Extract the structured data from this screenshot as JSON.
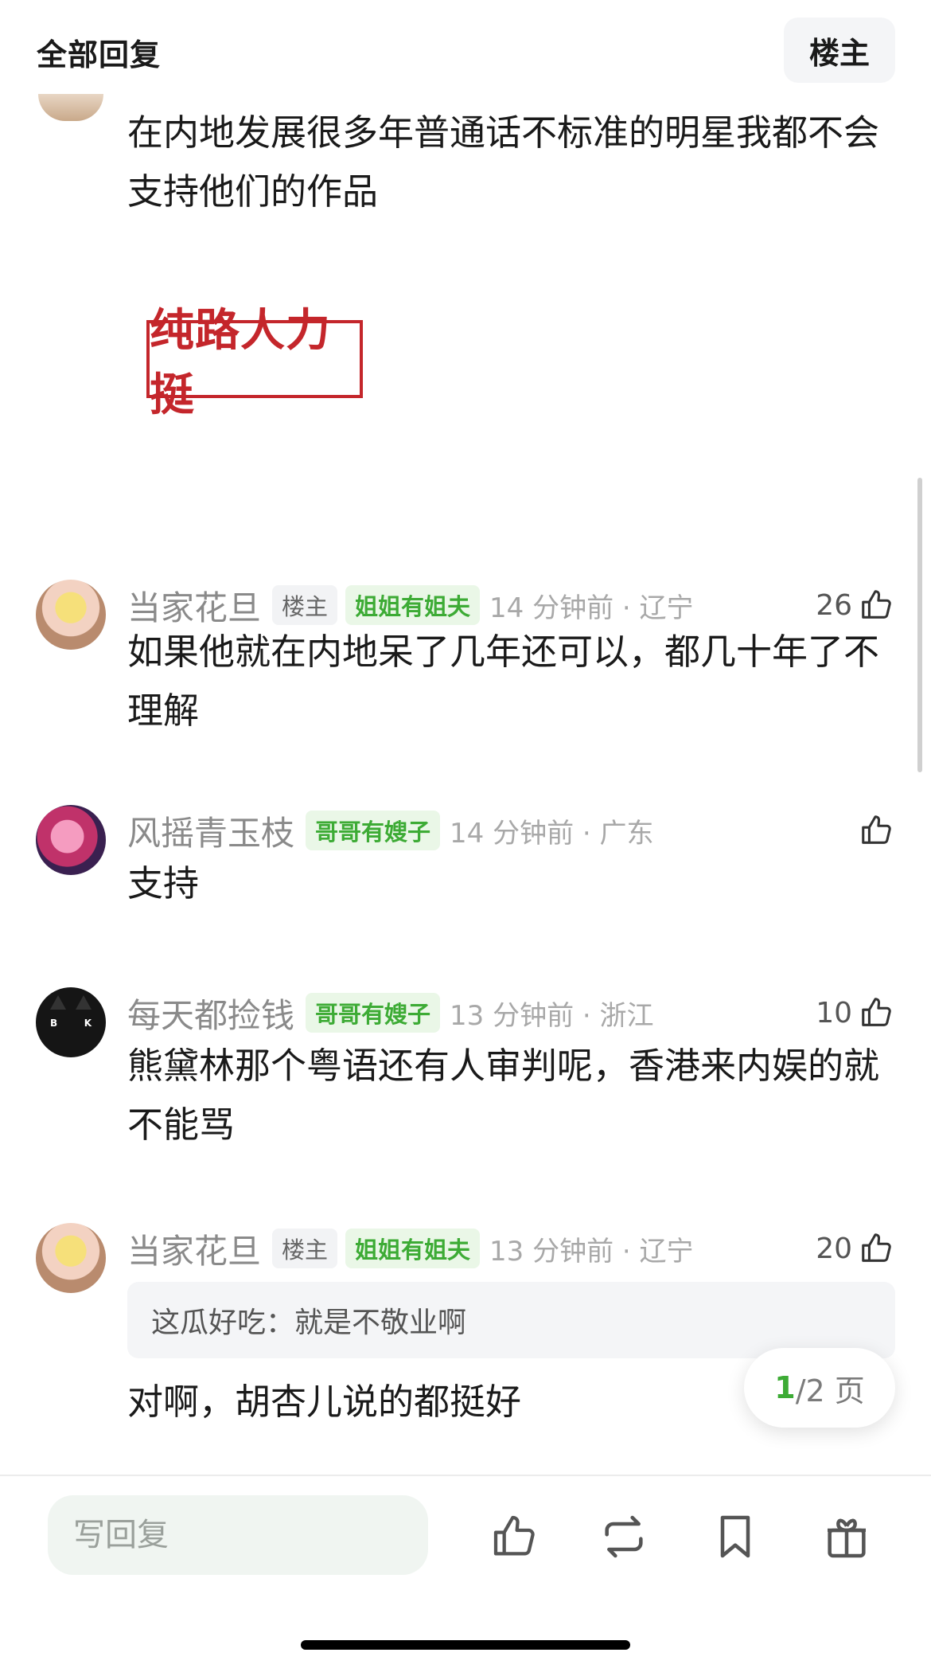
{
  "header": {
    "title": "全部回复",
    "op_button": "楼主"
  },
  "first_post": {
    "text": "在内地发展很多年普通话不标准的明星我都不会支持他们的作品",
    "stamp": "纯路人力挺"
  },
  "comments": [
    {
      "name": "当家花旦",
      "op_badge": "楼主",
      "tag": "姐姐有姐夫",
      "time": "14 分钟前 · 辽宁",
      "likes": "26",
      "text": "如果他就在内地呆了几年还可以，都几十年了不理解"
    },
    {
      "name": "风摇青玉枝",
      "tag": "哥哥有嫂子",
      "time": "14 分钟前 · 广东",
      "likes": "",
      "text": "支持"
    },
    {
      "name": "每天都捡钱",
      "tag": "哥哥有嫂子",
      "time": "13 分钟前 · 浙江",
      "likes": "10",
      "text": "熊黛林那个粤语还有人审判呢，香港来内娱的就不能骂"
    },
    {
      "name": "当家花旦",
      "op_badge": "楼主",
      "tag": "姐姐有姐夫",
      "time": "13 分钟前 · 辽宁",
      "likes": "20",
      "quote": "这瓜好吃：就是不敬业啊",
      "text": "对啊，胡杏儿说的都挺好"
    }
  ],
  "pager": {
    "current": "1",
    "rest": "/2 页"
  },
  "bottom": {
    "reply_placeholder": "写回复"
  },
  "avatar_cat_letters": {
    "left": "B",
    "right": "K"
  },
  "colors": {
    "accent_green": "#3dab35",
    "stamp_red": "#c4262b"
  },
  "icons": [
    "like-icon",
    "repost-icon",
    "bookmark-icon",
    "gift-icon"
  ]
}
